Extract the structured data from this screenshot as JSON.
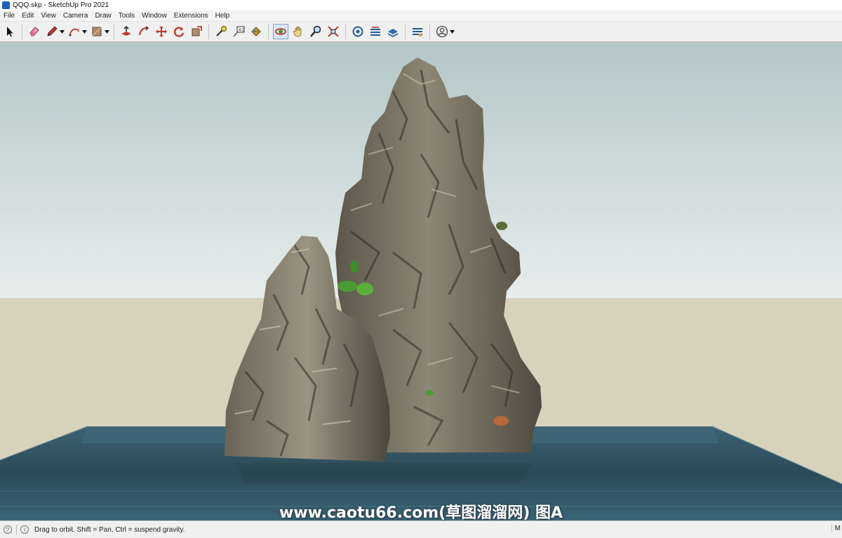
{
  "window": {
    "title": "QQQ.skp - SketchUp Pro 2021"
  },
  "menu": [
    "File",
    "Edit",
    "View",
    "Camera",
    "Draw",
    "Tools",
    "Window",
    "Extensions",
    "Help"
  ],
  "toolbar": {
    "icons": [
      "select-icon",
      "eraser-icon",
      "pencil-icon",
      "arc-icon",
      "shape-icon",
      "push-pull-icon",
      "follow-me-icon",
      "move-icon",
      "rotate-icon",
      "scale-icon",
      "tape-measure-icon",
      "text-icon",
      "paint-bucket-icon",
      "orbit-icon",
      "pan-icon",
      "zoom-icon",
      "zoom-extents-icon",
      "3d-warehouse-icon",
      "extension-warehouse-icon",
      "layout-icon",
      "extension-manager-icon",
      "account-icon"
    ]
  },
  "watermark": "www.caotu66.com(草图溜溜网) 图A",
  "status": {
    "text": "Drag to orbit. Shift = Pan, Ctrl = suspend gravity.",
    "measurements_label": "M"
  },
  "colors": {
    "sky_top": "#b7c9c8",
    "sky_bottom": "#e4eceb",
    "ground": "#d6d2bb",
    "water": "#2e4f5e",
    "active_tool": "#d8e6f6"
  }
}
